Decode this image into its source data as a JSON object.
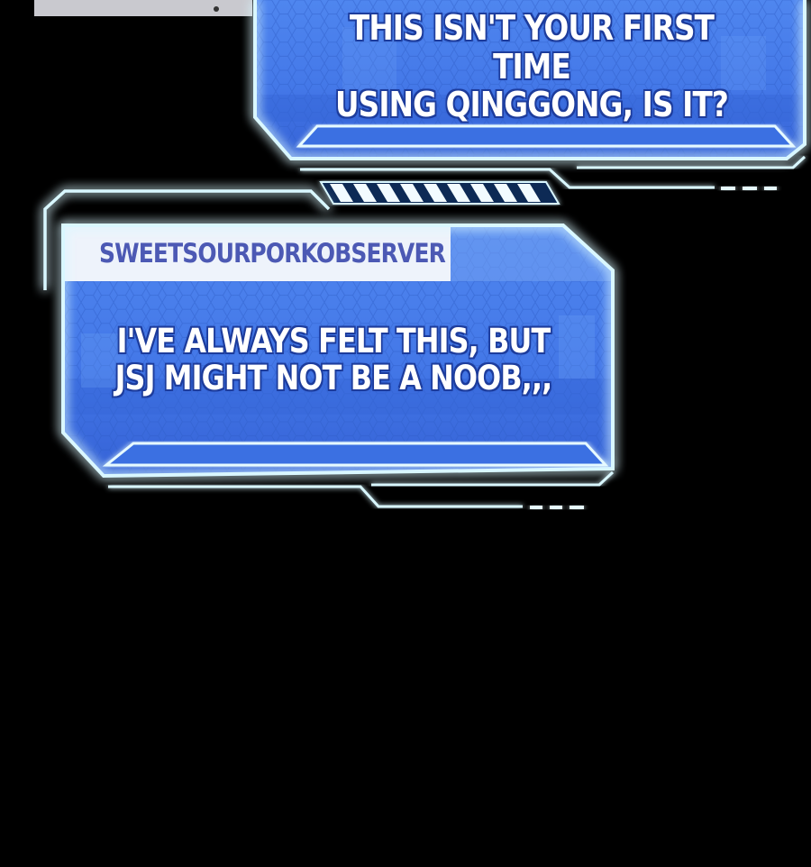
{
  "panel_top": {
    "lines": [
      "THIS ISN'T YOUR FIRST TIME",
      "USING QINGGONG, IS IT?"
    ]
  },
  "panel_bottom": {
    "username": "SWEETSOURPORKOBSERVER",
    "lines": [
      "I'VE ALWAYS FELT THIS, BUT",
      "JSJ MIGHT NOT BE A NOOB,,,"
    ]
  },
  "colors": {
    "background": "#000000",
    "panel_blue": "#3f73e6",
    "panel_light": "#5b93f2",
    "glow_cyan": "#5fd0ff",
    "username_text": "#4c59b4",
    "text_outline": "#1d3c9c"
  }
}
